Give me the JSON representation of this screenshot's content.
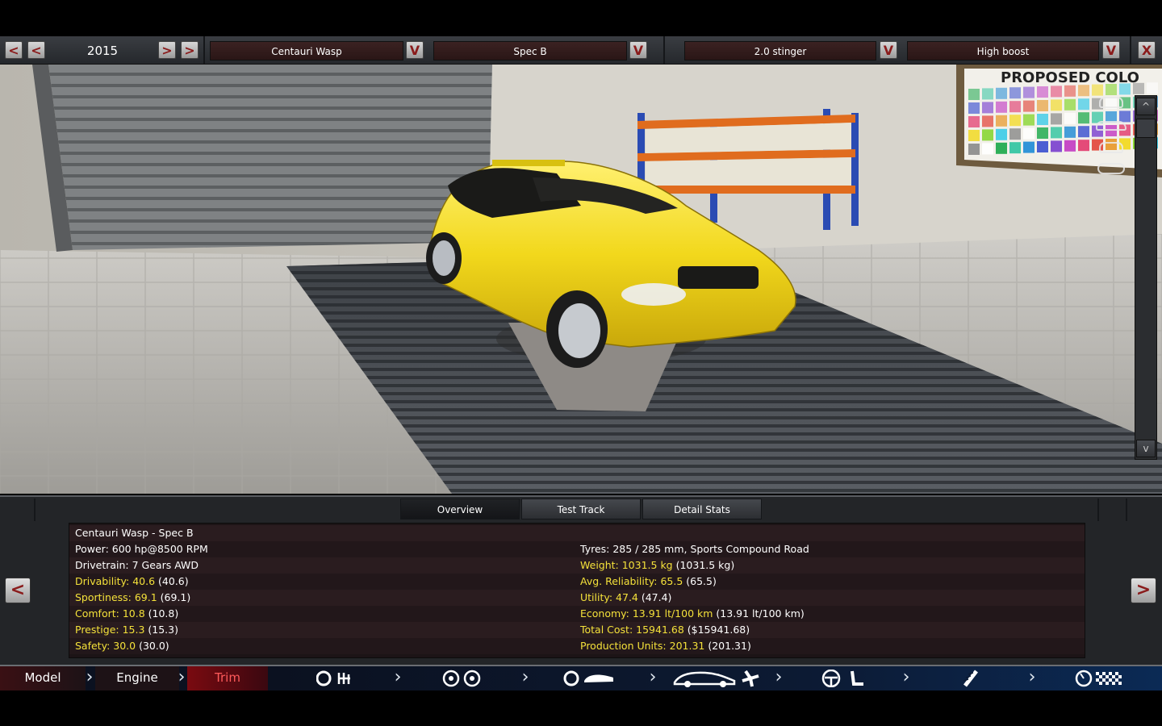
{
  "topbar": {
    "year": "2015",
    "prev_label": "<",
    "next_label": ">",
    "model": "Centauri  Wasp",
    "trim": "Spec B",
    "engine": "2.0 stinger",
    "engine_variant": "High boost",
    "dropdown_arrow": "V",
    "close_label": "X"
  },
  "scene": {
    "poster_text": "PROPOSED COLO"
  },
  "tabs": [
    {
      "label": "Overview",
      "active": true
    },
    {
      "label": "Test Track",
      "active": false
    },
    {
      "label": "Detail Stats",
      "active": false
    }
  ],
  "stats": {
    "title": "Centauri  Wasp - Spec B",
    "left": [
      {
        "label": "Power: 600 hp@8500 RPM",
        "extra": "",
        "highlight": false
      },
      {
        "label": "Drivetrain: 7 Gears AWD",
        "extra": "",
        "highlight": false
      },
      {
        "label": "Drivability: 40.6",
        "extra": " (40.6)",
        "highlight": true
      },
      {
        "label": "Sportiness: 69.1",
        "extra": " (69.1)",
        "highlight": true
      },
      {
        "label": "Comfort: 10.8",
        "extra": " (10.8)",
        "highlight": true
      },
      {
        "label": "Prestige: 15.3",
        "extra": " (15.3)",
        "highlight": true
      },
      {
        "label": "Safety: 30.0",
        "extra": " (30.0)",
        "highlight": true
      }
    ],
    "right": [
      {
        "label": "Tyres: 285 / 285 mm, Sports Compound Road",
        "extra": "",
        "highlight": false
      },
      {
        "label": "Weight: 1031.5 kg",
        "extra": " (1031.5 kg)",
        "highlight": true
      },
      {
        "label": "Avg. Reliability: 65.5",
        "extra": " (65.5)",
        "highlight": true
      },
      {
        "label": "Utility: 47.4",
        "extra": " (47.4)",
        "highlight": true
      },
      {
        "label": "Economy: 13.91 lt/100 km",
        "extra": " (13.91 lt/100 km)",
        "highlight": true
      },
      {
        "label": "Total Cost: 15941.68",
        "extra": " ($15941.68)",
        "highlight": true
      },
      {
        "label": "Production Units: 201.31",
        "extra": " (201.31)",
        "highlight": true
      }
    ]
  },
  "panel_nav": {
    "prev": "<",
    "next": ">"
  },
  "bottomnav": {
    "model": "Model",
    "engine": "Engine",
    "trim": "Trim",
    "icons": [
      "gearbox-icon",
      "wheels-icon",
      "body-icon",
      "fixtures-icon",
      "interior-icon",
      "suspension-icon",
      "testing-icon"
    ]
  },
  "colors": {
    "car_yellow": "#f2d81c",
    "stat_highlight": "#f4e13a",
    "trim_red": "#c8101a",
    "nav_blue": "#0b1120"
  }
}
